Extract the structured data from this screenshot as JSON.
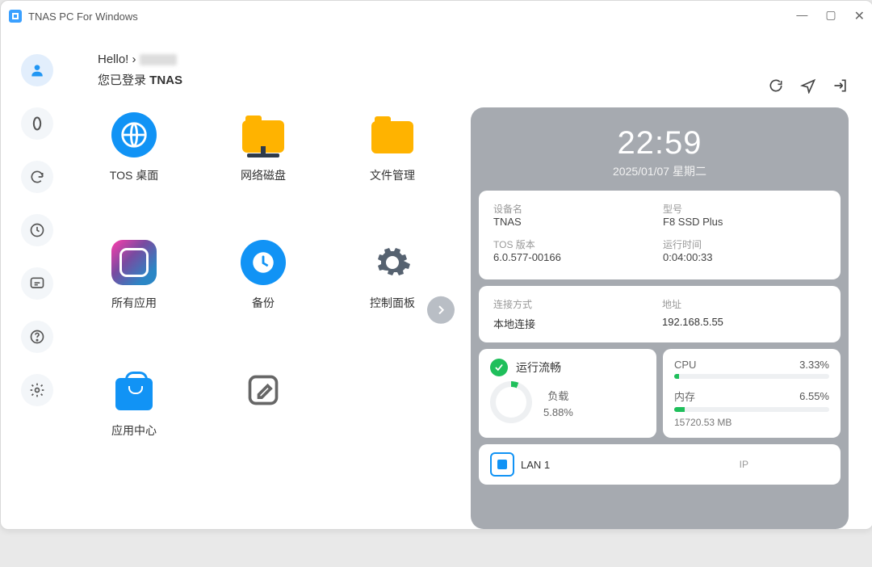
{
  "window": {
    "title": "TNAS PC For Windows"
  },
  "greeting": {
    "hello": "Hello! ›",
    "logged_in_prefix": "您已登录 ",
    "logged_in_name": "TNAS"
  },
  "apps": {
    "tos_desktop": "TOS 桌面",
    "net_disk": "网络磁盘",
    "file_mgr": "文件管理",
    "all_apps": "所有应用",
    "backup": "备份",
    "control_panel": "控制面板",
    "app_center": "应用中心"
  },
  "clock": {
    "time": "22:59",
    "date": "2025/01/07 星期二"
  },
  "device": {
    "name_label": "设备名",
    "name": "TNAS",
    "model_label": "型号",
    "model": "F8 SSD Plus",
    "tos_label": "TOS 版本",
    "tos": "6.0.577-00166",
    "uptime_label": "运行时间",
    "uptime": "0:04:00:33"
  },
  "net": {
    "conn_label": "连接方式",
    "conn": "本地连接",
    "addr_label": "地址",
    "addr": "192.168.5.55"
  },
  "status": {
    "smooth_label": "运行流畅",
    "load_label": "负载",
    "load_val": "5.88%",
    "cpu_label": "CPU",
    "cpu_val": "3.33%",
    "mem_label": "内存",
    "mem_val": "6.55%",
    "mem_total": "15720.53 MB"
  },
  "lan": {
    "name": "LAN 1",
    "ip_label": "IP"
  }
}
